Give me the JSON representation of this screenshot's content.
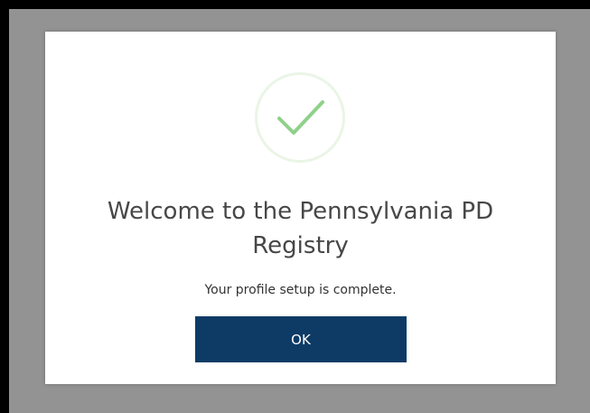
{
  "dialog": {
    "title": "Welcome to the Pennsylvania PD Registry",
    "message": "Your profile setup is complete.",
    "ok_label": "OK",
    "icon": "checkmark-icon"
  },
  "colors": {
    "overlay": "#939393",
    "dialog_background": "#ffffff",
    "button_background": "#0d3b66",
    "checkmark": "#8fd18a",
    "icon_ring": "#eaf5e6"
  }
}
